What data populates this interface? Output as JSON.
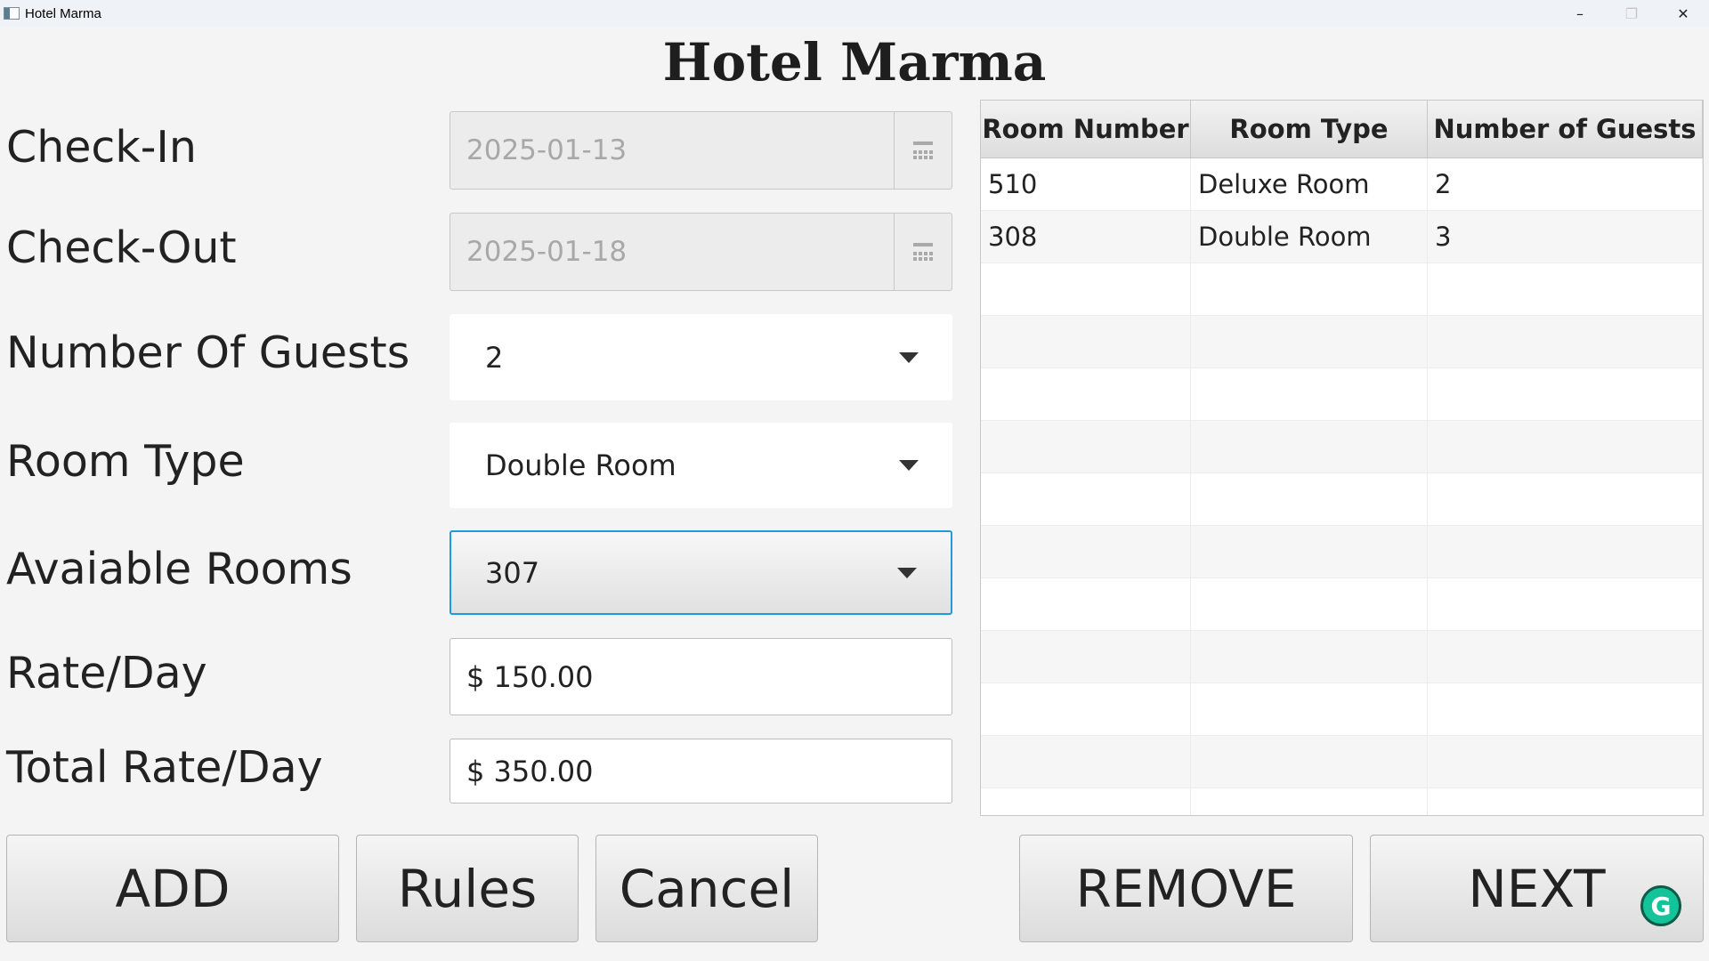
{
  "window": {
    "title": "Hotel Marma",
    "minimize_icon": "minimize-icon",
    "maximize_icon": "restore-icon",
    "close_icon": "close-icon"
  },
  "heading": "Hotel Marma",
  "form": {
    "checkin": {
      "label": "Check-In",
      "value": "2025-01-13",
      "icon": "calendar-icon"
    },
    "checkout": {
      "label": "Check-Out",
      "value": "2025-01-18",
      "icon": "calendar-icon"
    },
    "guests": {
      "label": "Number Of Guests",
      "value": "2"
    },
    "room_type": {
      "label": "Room Type",
      "value": "Double Room"
    },
    "available_rooms": {
      "label": "Avaiable Rooms",
      "value": "307"
    },
    "rate": {
      "label": "Rate/Day",
      "value": "$ 150.00"
    },
    "total_rate": {
      "label": "Total Rate/Day",
      "value": "$ 350.00"
    }
  },
  "table": {
    "columns": [
      "Room Number",
      "Room Type",
      "Number of Guests"
    ],
    "rows": [
      [
        "510",
        "Deluxe Room",
        "2"
      ],
      [
        "308",
        "Double Room",
        "3"
      ]
    ]
  },
  "buttons": {
    "add": "ADD",
    "rules": "Rules",
    "cancel": "Cancel",
    "remove": "REMOVE",
    "next": "NEXT"
  },
  "colors": {
    "focus_border": "#1b9be0",
    "grammarly": "#15c39a"
  }
}
